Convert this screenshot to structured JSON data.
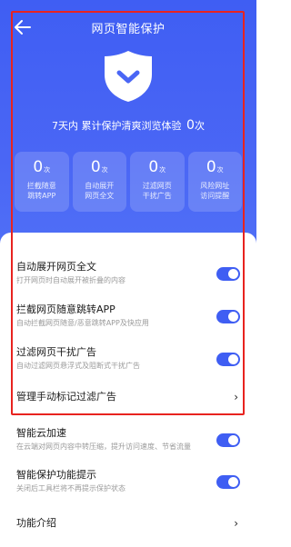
{
  "header": {
    "title": "网页智能保护"
  },
  "summary": {
    "text": "7天内 累计保护清爽浏览体验",
    "count": "0",
    "unit": "次"
  },
  "stats": [
    {
      "value": "0",
      "unit": "次",
      "label_line1": "拦截随意",
      "label_line2": "跳转APP"
    },
    {
      "value": "0",
      "unit": "次",
      "label_line1": "自动展开",
      "label_line2": "网页全文"
    },
    {
      "value": "0",
      "unit": "次",
      "label_line1": "过滤网页",
      "label_line2": "干扰广告"
    },
    {
      "value": "0",
      "unit": "次",
      "label_line1": "风险网址",
      "label_line2": "访问提醒"
    }
  ],
  "settings": [
    {
      "title": "自动展开网页全文",
      "desc": "打开网页时自动展开被折叠的内容",
      "on": true
    },
    {
      "title": "拦截网页随意跳转APP",
      "desc": "自动拦截网页随意/恶意跳转APP及快应用",
      "on": true
    },
    {
      "title": "过滤网页干扰广告",
      "desc": "自动过滤网页悬浮式及阻断式干扰广告",
      "on": true
    },
    {
      "title": "管理手动标记过滤广告",
      "chevron": "›"
    },
    {
      "title": "智能云加速",
      "desc": "在云端对网页内容中转压缩，提升访问速度、节省流量",
      "on": true
    },
    {
      "title": "智能保护功能提示",
      "desc": "关闭后工具栏将不再提示保护状态",
      "on": true
    },
    {
      "title": "功能介绍",
      "chevron": "›"
    }
  ],
  "colors": {
    "accent": "#3f5ef3",
    "highlight": "#e8231f"
  }
}
